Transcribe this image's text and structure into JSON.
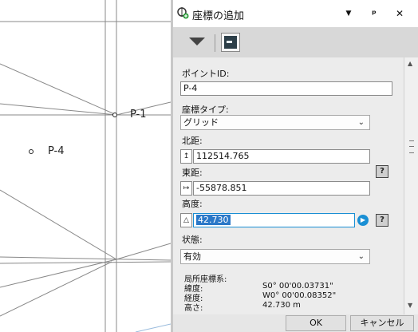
{
  "canvas": {
    "points": [
      {
        "label": "P-1"
      },
      {
        "label": "P-4"
      }
    ]
  },
  "palette": {
    "title": "座標の追加",
    "title_buttons": {
      "menu": "▼",
      "pin": "ᵖ",
      "close": "✕"
    },
    "toolbar": {
      "collapse_icon": "triangle-down",
      "window_icon": "window"
    },
    "fields": {
      "point_id": {
        "label": "ポイントID:",
        "value": "P-4"
      },
      "coord_type": {
        "label": "座標タイプ:",
        "value": "グリッド"
      },
      "northing": {
        "label": "北距:",
        "value": "112514.765"
      },
      "easting": {
        "label": "東距:",
        "value": "-55878.851"
      },
      "elevation": {
        "label": "高度:",
        "value": "42.730"
      },
      "status": {
        "label": "状態:",
        "value": "有効"
      }
    },
    "local_coords": {
      "heading": "局所座標系:",
      "rows": [
        {
          "label": "緯度:",
          "value": "S0° 00'00.03731\""
        },
        {
          "label": "経度:",
          "value": "W0° 00'00.08352\""
        },
        {
          "label": "高さ:",
          "value": "42.730 m"
        }
      ]
    },
    "help_label": "?",
    "ok_label": "OK",
    "cancel_label": "キャンセル"
  }
}
